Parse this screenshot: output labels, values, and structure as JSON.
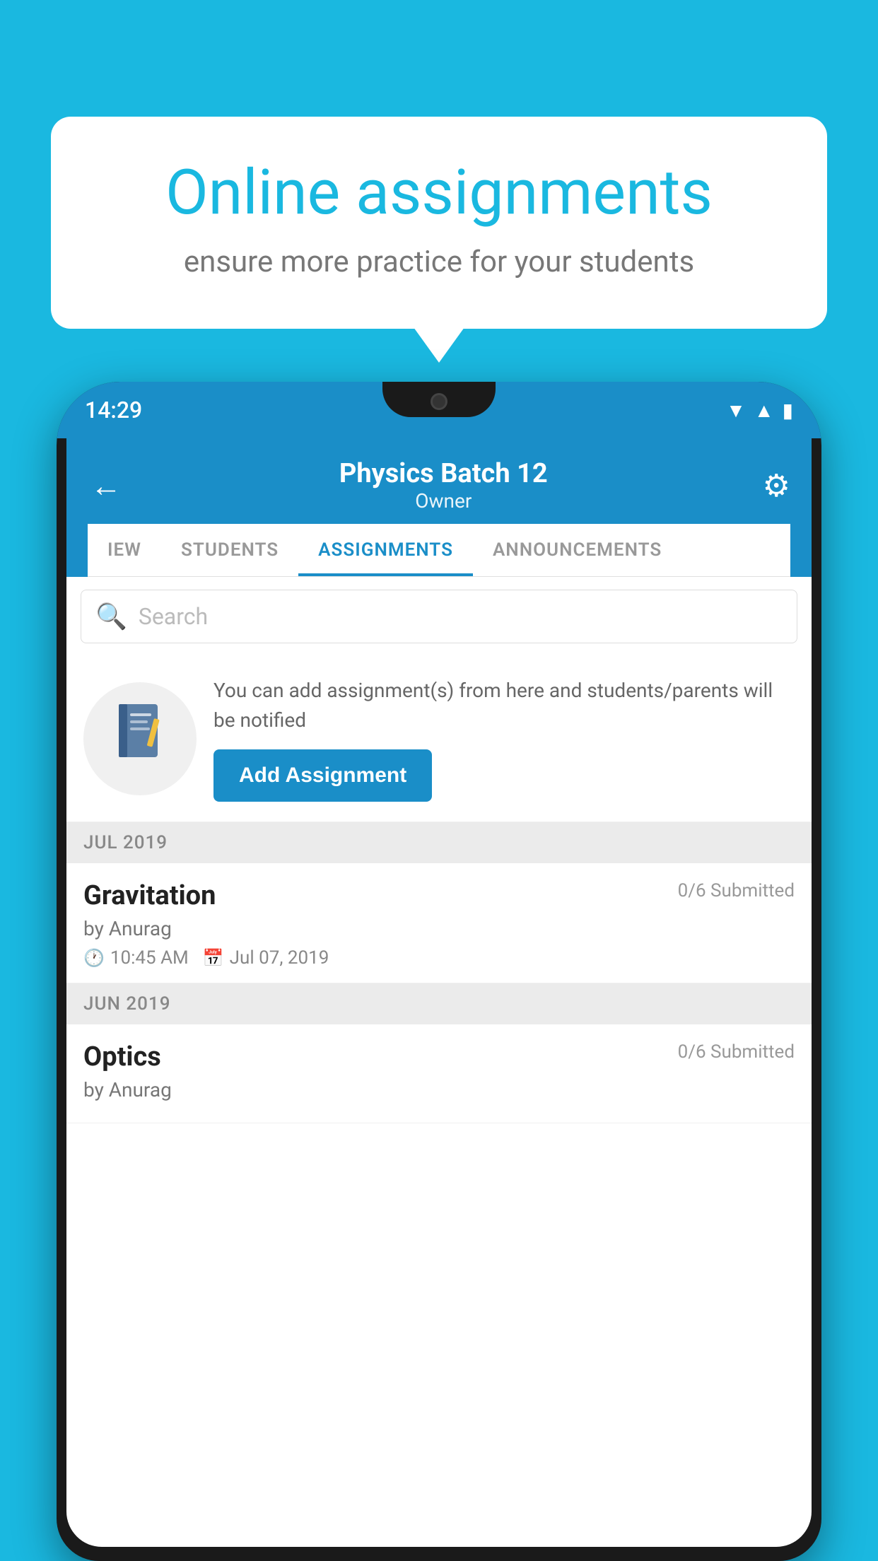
{
  "background_color": "#1ab8e0",
  "speech_bubble": {
    "title": "Online assignments",
    "subtitle": "ensure more practice for your students"
  },
  "phone": {
    "status_bar": {
      "time": "14:29",
      "icons": [
        "wifi",
        "signal",
        "battery"
      ]
    },
    "app": {
      "header": {
        "title": "Physics Batch 12",
        "subtitle": "Owner",
        "back_label": "←",
        "settings_label": "⚙"
      },
      "tabs": [
        {
          "label": "IEW",
          "active": false
        },
        {
          "label": "STUDENTS",
          "active": false
        },
        {
          "label": "ASSIGNMENTS",
          "active": true
        },
        {
          "label": "ANNOUNCEMENTS",
          "active": false
        }
      ],
      "search": {
        "placeholder": "Search",
        "icon": "🔍"
      },
      "promo": {
        "icon": "📓",
        "text": "You can add assignment(s) from here and students/parents will be notified",
        "button_label": "Add Assignment"
      },
      "sections": [
        {
          "header": "JUL 2019",
          "assignments": [
            {
              "name": "Gravitation",
              "submitted": "0/6 Submitted",
              "author": "by Anurag",
              "time": "10:45 AM",
              "date": "Jul 07, 2019"
            }
          ]
        },
        {
          "header": "JUN 2019",
          "assignments": [
            {
              "name": "Optics",
              "submitted": "0/6 Submitted",
              "author": "by Anurag",
              "time": "",
              "date": ""
            }
          ]
        }
      ]
    }
  }
}
